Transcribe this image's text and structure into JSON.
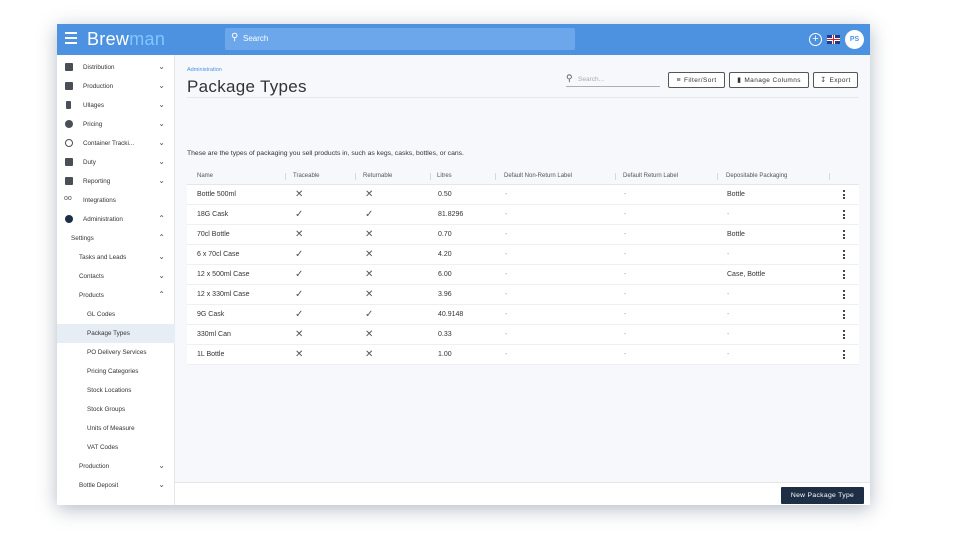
{
  "app": {
    "brand_main": "Brew",
    "brand_accent": "man",
    "search_placeholder": "Search",
    "user_initials": "PS"
  },
  "sidebar": {
    "items": [
      {
        "label": "Distribution",
        "icon": "truck-icon",
        "chevron": "down"
      },
      {
        "label": "Production",
        "icon": "beer-keg-icon",
        "chevron": "down"
      },
      {
        "label": "Ullages",
        "icon": "bottle-icon",
        "chevron": "down"
      },
      {
        "label": "Pricing",
        "icon": "dollar-icon",
        "chevron": "down"
      },
      {
        "label": "Container Tracki...",
        "icon": "target-icon",
        "chevron": "down"
      },
      {
        "label": "Duty",
        "icon": "document-icon",
        "chevron": "down"
      },
      {
        "label": "Reporting",
        "icon": "report-icon",
        "chevron": "down"
      },
      {
        "label": "Integrations",
        "icon": "link-icon",
        "chevron": ""
      },
      {
        "label": "Administration",
        "icon": "gear-icon",
        "chevron": "up"
      },
      {
        "label": "Settings",
        "icon": "",
        "chevron": "up"
      },
      {
        "label": "Tasks and Leads",
        "icon": "",
        "chevron": "down"
      },
      {
        "label": "Contacts",
        "icon": "",
        "chevron": "down"
      },
      {
        "label": "Products",
        "icon": "",
        "chevron": "up"
      },
      {
        "label": "GL Codes",
        "icon": "",
        "chevron": ""
      },
      {
        "label": "Package Types",
        "icon": "",
        "chevron": ""
      },
      {
        "label": "PO Delivery Services",
        "icon": "",
        "chevron": ""
      },
      {
        "label": "Pricing Categories",
        "icon": "",
        "chevron": ""
      },
      {
        "label": "Stock Locations",
        "icon": "",
        "chevron": ""
      },
      {
        "label": "Stock Groups",
        "icon": "",
        "chevron": ""
      },
      {
        "label": "Units of Measure",
        "icon": "",
        "chevron": ""
      },
      {
        "label": "VAT Codes",
        "icon": "",
        "chevron": ""
      },
      {
        "label": "Production",
        "icon": "",
        "chevron": "down"
      },
      {
        "label": "Bottle Deposit",
        "icon": "",
        "chevron": "down"
      }
    ]
  },
  "main": {
    "breadcrumb": "Administration",
    "title": "Package Types",
    "search_placeholder": "Search...",
    "filter_label": "Filter/Sort",
    "columns_label": "Manage Columns",
    "export_label": "Export",
    "description": "These are the types of packaging you sell products in, such as kegs, casks, bottles, or cans.",
    "new_button": "New Package Type"
  },
  "table": {
    "headers": [
      "Name",
      "Traceable",
      "Returnable",
      "Litres",
      "Default Non-Return Label",
      "Default Return Label",
      "Depositable Packaging"
    ],
    "rows": [
      {
        "name": "Bottle 500ml",
        "traceable": "✕",
        "returnable": "✕",
        "litres": "0.50",
        "non_return": "-",
        "return": "-",
        "depositable": "Bottle"
      },
      {
        "name": "18G Cask",
        "traceable": "✓",
        "returnable": "✓",
        "litres": "81.8296",
        "non_return": "-",
        "return": "-",
        "depositable": "-"
      },
      {
        "name": "70cl Bottle",
        "traceable": "✕",
        "returnable": "✕",
        "litres": "0.70",
        "non_return": "-",
        "return": "-",
        "depositable": "Bottle"
      },
      {
        "name": "6 x 70cl Case",
        "traceable": "✓",
        "returnable": "✕",
        "litres": "4.20",
        "non_return": "-",
        "return": "-",
        "depositable": "-"
      },
      {
        "name": "12 x 500ml Case",
        "traceable": "✓",
        "returnable": "✕",
        "litres": "6.00",
        "non_return": "-",
        "return": "-",
        "depositable": "Case, Bottle"
      },
      {
        "name": "12 x 330ml Case",
        "traceable": "✓",
        "returnable": "✕",
        "litres": "3.96",
        "non_return": "-",
        "return": "-",
        "depositable": "-"
      },
      {
        "name": "9G Cask",
        "traceable": "✓",
        "returnable": "✓",
        "litres": "40.9148",
        "non_return": "-",
        "return": "-",
        "depositable": "-"
      },
      {
        "name": "330ml Can",
        "traceable": "✕",
        "returnable": "✕",
        "litres": "0.33",
        "non_return": "-",
        "return": "-",
        "depositable": "-"
      },
      {
        "name": "1L Bottle",
        "traceable": "✕",
        "returnable": "✕",
        "litres": "1.00",
        "non_return": "-",
        "return": "-",
        "depositable": "-"
      }
    ]
  },
  "colors": {
    "topbar": "#4d92e0",
    "brand_accent": "#7fc7ff",
    "primary_button": "#1e2f45",
    "link": "#4d92e0"
  }
}
